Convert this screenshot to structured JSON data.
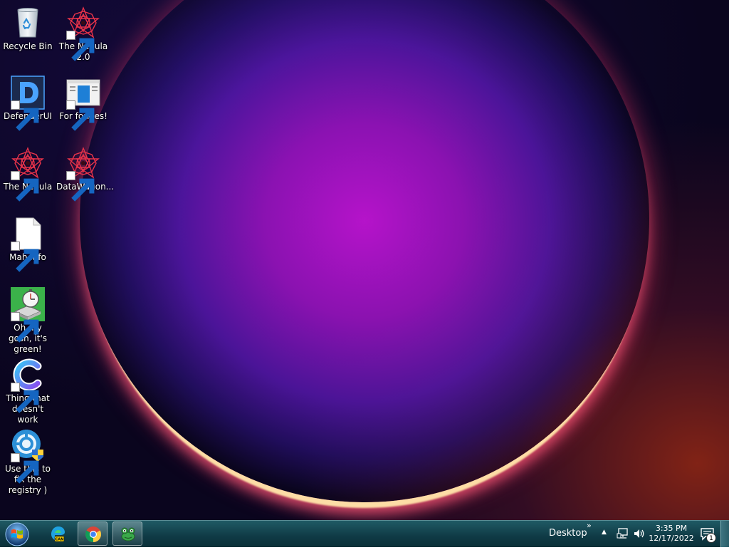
{
  "desktop": {
    "icons": [
      {
        "label": "Recycle Bin",
        "icon": "recycle-bin-icon"
      },
      {
        "label": "The Nebula 2.0",
        "icon": "nebula-icon"
      },
      {
        "label": "DefenderUI",
        "icon": "defenderui-icon"
      },
      {
        "label": "For forkies!",
        "icon": "window-app-icon"
      },
      {
        "label": "The Nebula",
        "icon": "nebula-icon"
      },
      {
        "label": "DataWagon...",
        "icon": "nebula-icon"
      },
      {
        "label": "Mah info",
        "icon": "blank-file-icon"
      },
      {
        "label": "Oh my gosh, it's green!",
        "icon": "disk-cleanup-icon"
      },
      {
        "label": "Thing that doesn't work",
        "icon": "c-logo-icon"
      },
      {
        "label": "Use this to fix the registry )",
        "icon": "registry-fix-icon"
      }
    ]
  },
  "taskbar": {
    "pinned": [
      {
        "name": "edge-can-icon",
        "active": false
      },
      {
        "name": "chrome-icon",
        "active": true
      },
      {
        "name": "frog-app-icon",
        "active": true
      }
    ],
    "toolbar_label": "Desktop",
    "toolbar_chevron": "»",
    "tray_arrow": "▲",
    "clock_time": "3:35 PM",
    "clock_date": "12/17/2022",
    "notification_count": "1"
  }
}
